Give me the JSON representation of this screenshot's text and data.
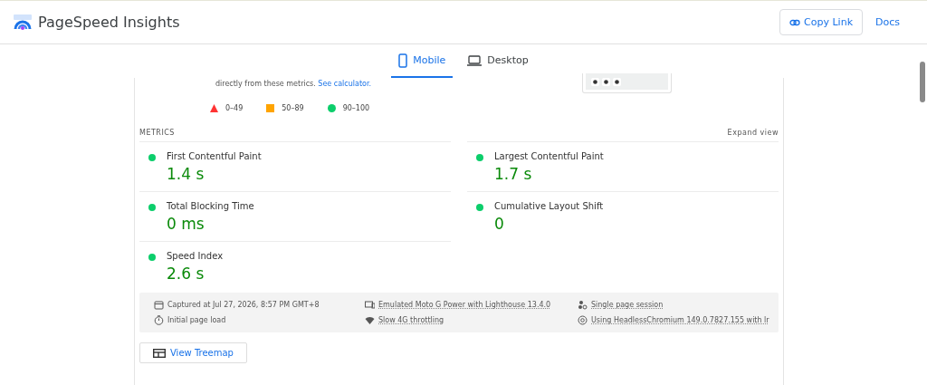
{
  "header": {
    "title": "PageSpeed Insights",
    "buttons": [
      {
        "label": "Copy Link",
        "kind": "outlined"
      },
      {
        "label": "Docs",
        "kind": "text"
      }
    ]
  },
  "tabs": [
    {
      "label": "Mobile",
      "kind": "phone",
      "selected": true
    },
    {
      "label": "Desktop",
      "kind": "laptop",
      "selected": false
    }
  ],
  "intro": {
    "text": "directly from these metrics.",
    "link": "See calculator."
  },
  "legend": [
    {
      "kind": "fail",
      "label": "0–49"
    },
    {
      "kind": "average",
      "label": "50–89"
    },
    {
      "kind": "pass",
      "label": "90–100"
    }
  ],
  "metrics": {
    "heading": "METRICS",
    "expand": "Expand view",
    "items": [
      {
        "name": "First Contentful Paint",
        "value": "1.4 s",
        "color": "#0cce6b"
      },
      {
        "name": "Largest Contentful Paint",
        "value": "1.7 s",
        "color": "#0cce6b"
      },
      {
        "name": "Total Blocking Time",
        "value": "0 ms",
        "color": "#0cce6b"
      },
      {
        "name": "Cumulative Layout Shift",
        "value": "0",
        "color": "#0cce6b"
      },
      {
        "name": "Speed Index",
        "value": "2.6 s",
        "color": "#0cce6b"
      }
    ]
  },
  "info": [
    {
      "kind": "calendar",
      "text": "Captured at Jul 27, 2026, 8:57 PM GMT+8",
      "link": false
    },
    {
      "kind": "device",
      "text": "Emulated Moto G Power with Lighthouse 13.4.0",
      "link": true
    },
    {
      "kind": "users",
      "text": "Single page session",
      "link": true
    },
    {
      "kind": "timer",
      "text": "Initial page load",
      "link": false
    },
    {
      "kind": "wifi",
      "text": "Slow 4G throttling",
      "link": true
    },
    {
      "kind": "browser",
      "text": "Using HeadlessChromium 149.0.7827.155 with lr",
      "link": true
    }
  ],
  "treemap_button": "View Treemap"
}
